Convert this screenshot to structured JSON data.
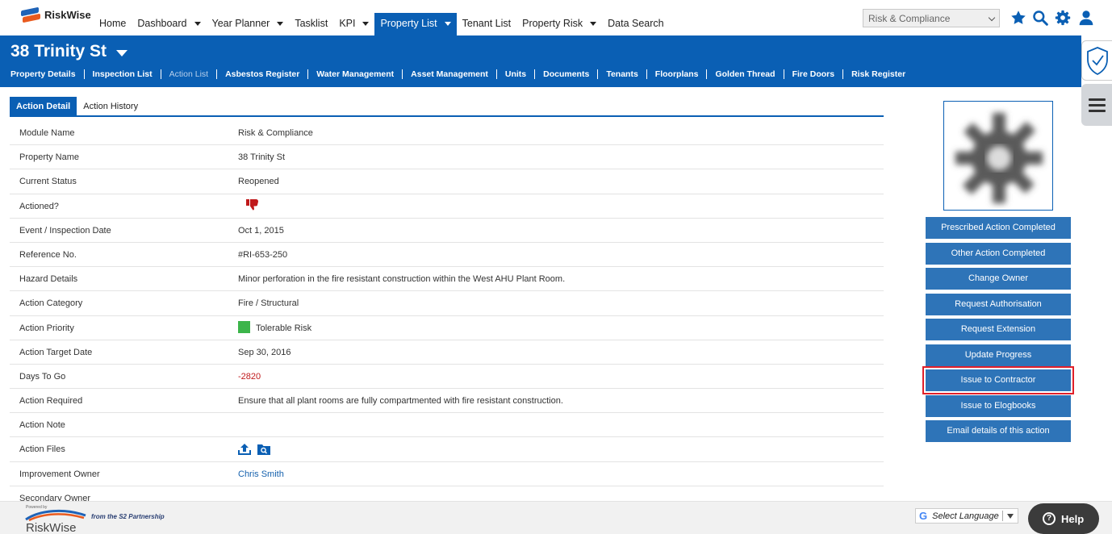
{
  "app": {
    "name": "RiskWise"
  },
  "nav": {
    "items": [
      {
        "label": "Home",
        "caret": false,
        "active": false
      },
      {
        "label": "Dashboard",
        "caret": true,
        "active": false
      },
      {
        "label": "Year Planner",
        "caret": true,
        "active": false
      },
      {
        "label": "Tasklist",
        "caret": false,
        "active": false
      },
      {
        "label": "KPI",
        "caret": true,
        "active": false
      },
      {
        "label": "Property List",
        "caret": true,
        "active": true
      },
      {
        "label": "Tenant List",
        "caret": false,
        "active": false
      },
      {
        "label": "Property Risk",
        "caret": true,
        "active": false
      },
      {
        "label": "Data Search",
        "caret": false,
        "active": false
      }
    ],
    "module_select": "Risk & Compliance",
    "icons": [
      "star-icon",
      "search-icon",
      "gear-icon",
      "user-icon"
    ]
  },
  "property": {
    "title": "38 Trinity St",
    "subnav": [
      {
        "label": "Property Details",
        "dim": false
      },
      {
        "label": "Inspection List",
        "dim": false
      },
      {
        "label": "Action List",
        "dim": true
      },
      {
        "label": "Asbestos Register",
        "dim": false
      },
      {
        "label": "Water Management",
        "dim": false
      },
      {
        "label": "Asset Management",
        "dim": false
      },
      {
        "label": "Units",
        "dim": false
      },
      {
        "label": "Documents",
        "dim": false
      },
      {
        "label": "Tenants",
        "dim": false
      },
      {
        "label": "Floorplans",
        "dim": false
      },
      {
        "label": "Golden Thread",
        "dim": false
      },
      {
        "label": "Fire Doors",
        "dim": false
      },
      {
        "label": "Risk Register",
        "dim": false
      }
    ]
  },
  "tabs": [
    {
      "label": "Action Detail",
      "active": true
    },
    {
      "label": "Action History",
      "active": false
    }
  ],
  "details": [
    {
      "label": "Module Name",
      "value": "Risk & Compliance"
    },
    {
      "label": "Property Name",
      "value": "38 Trinity St"
    },
    {
      "label": "Current Status",
      "value": "Reopened"
    },
    {
      "label": "Actioned?",
      "value": "",
      "icon": "thumbs-down-icon"
    },
    {
      "label": "Event / Inspection Date",
      "value": "Oct 1, 2015"
    },
    {
      "label": "Reference No.",
      "value": "#RI-653-250"
    },
    {
      "label": "Hazard Details",
      "value": "Minor perforation in the fire resistant construction within the West AHU Plant Room."
    },
    {
      "label": "Action Category",
      "value": "Fire / Structural"
    },
    {
      "label": "Action Priority",
      "value": "Tolerable Risk",
      "swatch": "#3cb54a"
    },
    {
      "label": "Action Target Date",
      "value": "Sep 30, 2016"
    },
    {
      "label": "Days To Go",
      "value": "-2820",
      "style": "red"
    },
    {
      "label": "Action Required",
      "value": "Ensure that all plant rooms are fully compartmented with fire resistant construction."
    },
    {
      "label": "Action Note",
      "value": ""
    },
    {
      "label": "Action Files",
      "value": "",
      "icon": "file-actions-icon"
    },
    {
      "label": "Improvement Owner",
      "value": "Chris Smith",
      "style": "link"
    },
    {
      "label": "Secondary Owner",
      "value": ""
    }
  ],
  "actions": [
    {
      "label": "Prescribed Action Completed",
      "highlight": false
    },
    {
      "label": "Other Action Completed",
      "highlight": false
    },
    {
      "label": "Change Owner",
      "highlight": false
    },
    {
      "label": "Request Authorisation",
      "highlight": false
    },
    {
      "label": "Request Extension",
      "highlight": false
    },
    {
      "label": "Update Progress",
      "highlight": false
    },
    {
      "label": "Issue to Contractor",
      "highlight": true
    },
    {
      "label": "Issue to Elogbooks",
      "highlight": false
    },
    {
      "label": "Email details of this action",
      "highlight": false
    }
  ],
  "footer": {
    "powered_by": "Powered by",
    "logo_text": "RiskWise",
    "tagline": "from the S2 Partnership",
    "language": "Select Language",
    "help": "Help"
  },
  "colors": {
    "brand_blue": "#0a5fb4",
    "button_blue": "#2e74b8",
    "highlight_red": "#e0202a",
    "negative_red": "#c0191b"
  }
}
